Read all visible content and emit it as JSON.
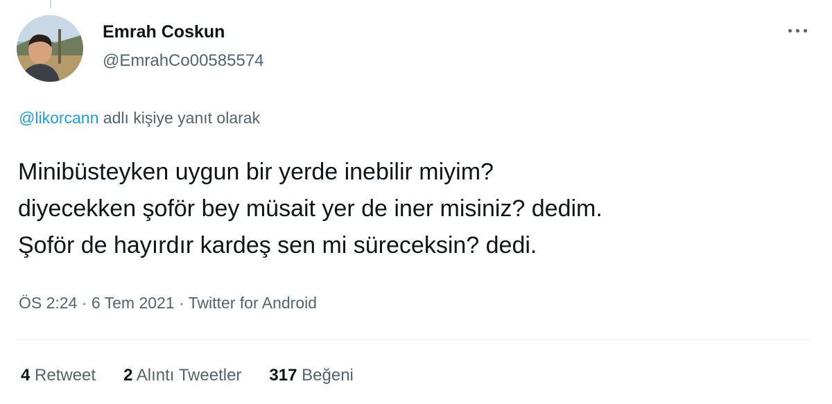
{
  "user": {
    "display_name": "Emrah Coskun",
    "handle": "@EmrahCo00585574"
  },
  "reply": {
    "mention": "@likorcann",
    "suffix": "adlı kişiye yanıt olarak"
  },
  "tweet": {
    "lines": [
      "Minibüsteyken uygun bir yerde inebilir miyim?",
      "diyecekken şoför bey müsait yer de iner misiniz? dedim.",
      "Şoför de hayırdır kardeş sen mi süreceksin? dedi."
    ]
  },
  "meta": {
    "time": "ÖS 2:24",
    "separator": "·",
    "date": "6 Tem 2021",
    "source": "Twitter for Android"
  },
  "stats": {
    "retweets": {
      "count": "4",
      "label": "Retweet"
    },
    "quotes": {
      "count": "2",
      "label": "Alıntı Tweetler"
    },
    "likes": {
      "count": "317",
      "label": "Beğeni"
    }
  },
  "icons": {
    "more": "more-horizontal-icon"
  }
}
